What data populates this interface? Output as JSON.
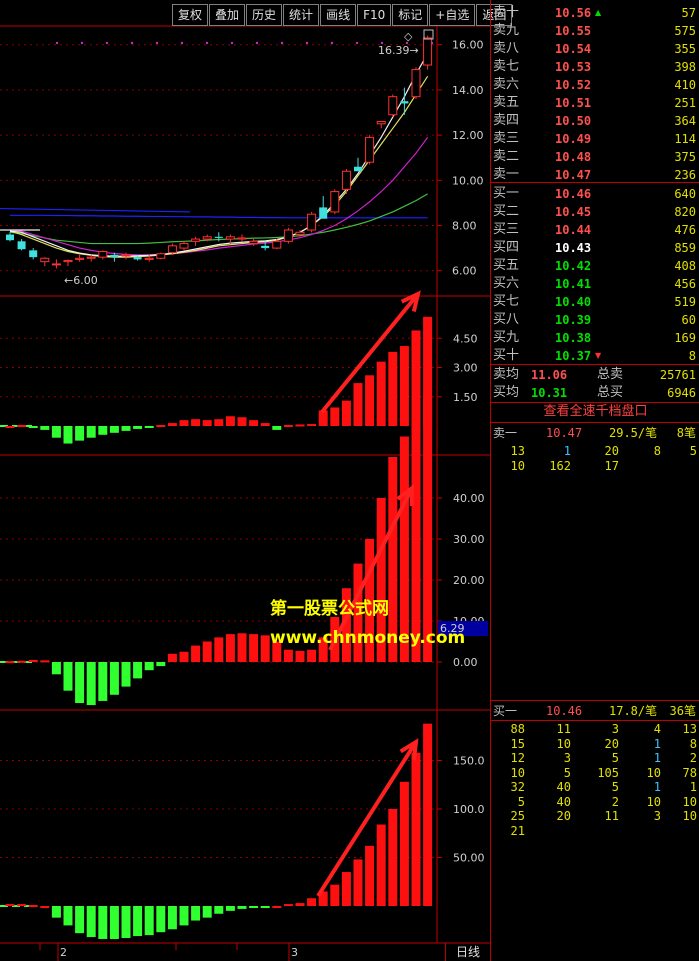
{
  "toolbar": {
    "buttons": [
      "复权",
      "叠加",
      "历史",
      "统计",
      "画线",
      "F10",
      "标记",
      "+自选",
      "返回"
    ]
  },
  "price_chart": {
    "high_label": "16.39",
    "low_label": "6.00",
    "y_ticks": [
      "16.00",
      "14.00",
      "12.00",
      "10.00",
      "8.00",
      "6.00"
    ],
    "candles": [
      [
        7.6,
        7.7,
        7.3,
        7.35
      ],
      [
        7.3,
        7.4,
        6.9,
        6.95
      ],
      [
        6.9,
        7.0,
        6.5,
        6.6
      ],
      [
        6.4,
        6.6,
        6.2,
        6.55
      ],
      [
        6.3,
        6.5,
        6.1,
        6.3
      ],
      [
        6.4,
        6.5,
        6.2,
        6.45
      ],
      [
        6.5,
        6.7,
        6.4,
        6.55
      ],
      [
        6.55,
        6.7,
        6.4,
        6.6
      ],
      [
        6.6,
        6.9,
        6.5,
        6.85
      ],
      [
        6.7,
        6.8,
        6.4,
        6.6
      ],
      [
        6.65,
        6.8,
        6.5,
        6.7
      ],
      [
        6.6,
        6.7,
        6.45,
        6.5
      ],
      [
        6.5,
        6.7,
        6.4,
        6.55
      ],
      [
        6.55,
        6.8,
        6.5,
        6.75
      ],
      [
        6.8,
        7.2,
        6.7,
        7.1
      ],
      [
        7.0,
        7.3,
        6.9,
        7.2
      ],
      [
        7.3,
        7.5,
        7.1,
        7.4
      ],
      [
        7.4,
        7.6,
        7.3,
        7.5
      ],
      [
        7.5,
        7.7,
        7.3,
        7.45
      ],
      [
        7.4,
        7.6,
        7.2,
        7.5
      ],
      [
        7.4,
        7.6,
        7.3,
        7.45
      ],
      [
        7.2,
        7.4,
        7.1,
        7.3
      ],
      [
        7.1,
        7.3,
        6.9,
        7.0
      ],
      [
        7.0,
        7.4,
        6.95,
        7.3
      ],
      [
        7.3,
        7.9,
        7.2,
        7.8
      ],
      [
        7.6,
        7.8,
        7.5,
        7.7
      ],
      [
        7.8,
        8.6,
        7.7,
        8.5
      ],
      [
        8.8,
        8.7,
        9.3,
        8.3
      ],
      [
        8.6,
        9.6,
        8.5,
        9.5
      ],
      [
        9.6,
        10.5,
        9.4,
        10.4
      ],
      [
        10.6,
        10.5,
        11.0,
        10.4
      ],
      [
        10.8,
        12.0,
        10.7,
        11.9
      ],
      [
        12.5,
        12.6,
        12.3,
        12.6
      ],
      [
        12.9,
        13.8,
        12.8,
        13.7
      ],
      [
        13.5,
        14.1,
        12.9,
        13.4
      ],
      [
        13.7,
        15.0,
        13.6,
        14.9
      ],
      [
        15.1,
        16.4,
        14.9,
        16.3
      ]
    ],
    "ma_yellow": [
      7.75,
      7.6,
      7.4,
      7.2,
      7.0,
      6.85,
      6.75,
      6.68,
      6.62,
      6.6,
      6.6,
      6.62,
      6.65,
      6.7,
      6.75,
      6.82,
      6.9,
      7.0,
      7.1,
      7.15,
      7.2,
      7.25,
      7.28,
      7.35,
      7.5,
      7.7,
      8.0,
      8.4,
      8.9,
      9.5,
      10.2,
      10.9,
      11.6,
      12.3,
      13.0,
      13.8,
      14.6
    ],
    "ma_green": [
      7.7,
      7.65,
      7.55,
      7.45,
      7.35,
      7.3,
      7.25,
      7.2,
      7.2,
      7.2,
      7.2,
      7.2,
      7.22,
      7.25,
      7.28,
      7.3,
      7.32,
      7.35,
      7.38,
      7.4,
      7.42,
      7.44,
      7.45,
      7.47,
      7.5,
      7.55,
      7.62,
      7.7,
      7.8,
      7.92,
      8.05,
      8.2,
      8.4,
      8.6,
      8.85,
      9.1,
      9.4
    ],
    "ma_magenta": [
      7.8,
      7.75,
      7.6,
      7.45,
      7.3,
      7.15,
      7.0,
      6.9,
      6.82,
      6.76,
      6.72,
      6.7,
      6.7,
      6.72,
      6.75,
      6.8,
      6.86,
      6.92,
      7.0,
      7.06,
      7.12,
      7.18,
      7.22,
      7.28,
      7.36,
      7.46,
      7.6,
      7.78,
      8.0,
      8.3,
      8.65,
      9.05,
      9.5,
      10.0,
      10.6,
      11.2,
      11.9
    ],
    "ma_white": [
      7.75,
      7.7,
      7.5,
      7.3,
      7.1,
      6.9,
      6.78,
      6.7,
      6.66,
      6.64,
      6.64,
      6.66,
      6.68,
      6.72,
      6.78,
      6.86,
      6.96,
      7.06,
      7.16,
      7.22,
      7.26,
      7.3,
      7.32,
      7.38,
      7.5,
      7.7,
      8.0,
      8.45,
      9.0,
      9.6,
      10.3,
      11.1,
      11.9,
      12.8,
      13.7,
      14.7,
      15.6
    ],
    "ma_blue": [
      8.45,
      8.45,
      8.45,
      8.45,
      8.44,
      8.44,
      8.43,
      8.43,
      8.42,
      8.42,
      8.41,
      8.41,
      8.4,
      8.4,
      8.39,
      8.39,
      8.38,
      8.38,
      8.37,
      8.37,
      8.36,
      8.36,
      8.35,
      8.35,
      8.34,
      8.34,
      8.34,
      8.34,
      8.34,
      8.34,
      8.34,
      8.34,
      8.34,
      8.34,
      8.34,
      8.34,
      8.34
    ]
  },
  "macd1": {
    "y_ticks": [
      "4.50",
      "3.00",
      "1.50"
    ],
    "values": [
      0,
      0.05,
      -0.1,
      -0.2,
      -0.6,
      -0.9,
      -0.75,
      -0.6,
      -0.45,
      -0.35,
      -0.25,
      -0.15,
      -0.1,
      0.05,
      0.15,
      0.3,
      0.35,
      0.3,
      0.35,
      0.5,
      0.45,
      0.3,
      0.15,
      -0.2,
      0.05,
      0.08,
      0.1,
      0.8,
      0.95,
      1.3,
      2.2,
      2.6,
      3.3,
      3.8,
      4.1,
      4.9,
      5.6
    ]
  },
  "macd2": {
    "y_ticks": [
      "40.00",
      "30.00",
      "20.00",
      "10.00",
      "0.00"
    ],
    "current_label": "6.29",
    "values": [
      0.2,
      0.3,
      0.5,
      0.4,
      -3,
      -7,
      -10,
      -10.5,
      -9.5,
      -8,
      -6,
      -4,
      -2,
      -1,
      2,
      2.5,
      4,
      5,
      6,
      6.8,
      7,
      6.8,
      6.5,
      5,
      3,
      2.7,
      3,
      6,
      11,
      18,
      24,
      30,
      40,
      50,
      55,
      60,
      65
    ]
  },
  "macd3": {
    "y_ticks": [
      "150.0",
      "100.0",
      "50.00"
    ],
    "values": [
      2,
      2,
      1,
      0,
      -12,
      -20,
      -28,
      -32,
      -34,
      -34,
      -33,
      -31,
      -30,
      -27,
      -24,
      -20,
      -15,
      -12,
      -8,
      -5,
      -3,
      -2,
      -1,
      0,
      2,
      3,
      8,
      15,
      22,
      35,
      48,
      62,
      84,
      100,
      128,
      158,
      188
    ]
  },
  "axis": {
    "x_labels": [
      "2",
      "3"
    ],
    "period": "日线"
  },
  "order_book": {
    "sell": [
      {
        "label": "卖十",
        "price": "10.56",
        "vol": "57",
        "marker": "▲"
      },
      {
        "label": "卖九",
        "price": "10.55",
        "vol": "575"
      },
      {
        "label": "卖八",
        "price": "10.54",
        "vol": "355"
      },
      {
        "label": "卖七",
        "price": "10.53",
        "vol": "398"
      },
      {
        "label": "卖六",
        "price": "10.52",
        "vol": "410"
      },
      {
        "label": "卖五",
        "price": "10.51",
        "vol": "251"
      },
      {
        "label": "卖四",
        "price": "10.50",
        "vol": "364"
      },
      {
        "label": "卖三",
        "price": "10.49",
        "vol": "114"
      },
      {
        "label": "卖二",
        "price": "10.48",
        "vol": "375"
      },
      {
        "label": "卖一",
        "price": "10.47",
        "vol": "236"
      }
    ],
    "buy": [
      {
        "label": "买一",
        "price": "10.46",
        "vol": "640",
        "color": "red"
      },
      {
        "label": "买二",
        "price": "10.45",
        "vol": "820",
        "color": "red"
      },
      {
        "label": "买三",
        "price": "10.44",
        "vol": "476",
        "color": "red"
      },
      {
        "label": "买四",
        "price": "10.43",
        "vol": "859",
        "color": "white"
      },
      {
        "label": "买五",
        "price": "10.42",
        "vol": "408",
        "color": "green"
      },
      {
        "label": "买六",
        "price": "10.41",
        "vol": "456",
        "color": "green"
      },
      {
        "label": "买七",
        "price": "10.40",
        "vol": "519",
        "color": "green"
      },
      {
        "label": "买八",
        "price": "10.39",
        "vol": "60",
        "color": "green"
      },
      {
        "label": "买九",
        "price": "10.38",
        "vol": "169",
        "color": "green"
      },
      {
        "label": "买十",
        "price": "10.37",
        "vol": "8",
        "color": "green",
        "marker": "▼"
      }
    ],
    "avg_sell_label": "卖均",
    "avg_sell_price": "11.06",
    "total_sell_label": "总卖",
    "total_sell": "25761",
    "avg_buy_label": "买均",
    "avg_buy_price": "10.31",
    "total_buy_label": "总买",
    "total_buy": "6946",
    "link": "查看全速千档盘口"
  },
  "sell1_queue": {
    "label": "卖一",
    "price": "10.47",
    "avg": "29.5/笔",
    "count": "8笔",
    "rows": [
      [
        "13",
        "1",
        "20",
        "8",
        "5"
      ],
      [
        "10",
        "162",
        "17",
        "",
        ""
      ]
    ]
  },
  "buy1_queue": {
    "label": "买一",
    "price": "10.46",
    "avg": "17.8/笔",
    "count": "36笔",
    "rows": [
      [
        "88",
        "11",
        "3",
        "4",
        "13"
      ],
      [
        "15",
        "10",
        "20",
        "1",
        "8"
      ],
      [
        "12",
        "3",
        "5",
        "1",
        "2"
      ],
      [
        "10",
        "5",
        "105",
        "10",
        "78"
      ],
      [
        "32",
        "40",
        "5",
        "1",
        "1"
      ],
      [
        "5",
        "40",
        "2",
        "10",
        "10"
      ],
      [
        "25",
        "20",
        "11",
        "3",
        "10"
      ],
      [
        "21",
        "",
        "",
        "",
        ""
      ]
    ]
  },
  "watermark": {
    "line1": "第一股票公式网",
    "line2": "www.chnmoney.com"
  },
  "colors": {
    "up": "#ff2020",
    "down": "#40ff40",
    "cyan": "#40e0e0",
    "accent_border": "#c00000"
  }
}
